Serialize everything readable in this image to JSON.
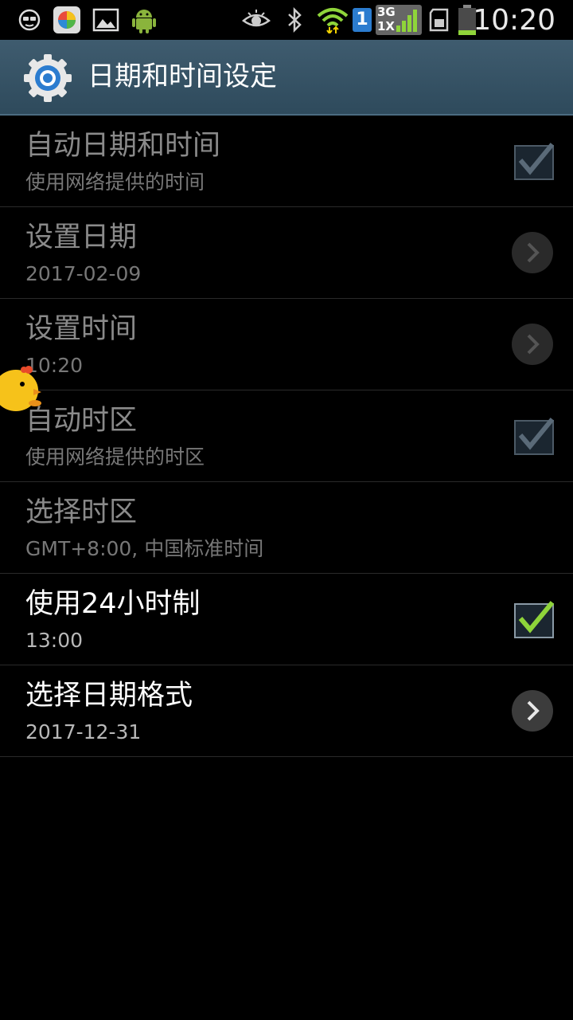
{
  "status_bar": {
    "time": "10:20",
    "icons": [
      "incognito-icon",
      "game-center-icon",
      "gallery-icon",
      "android-icon",
      "eye-icon",
      "bluetooth-icon",
      "wifi-icon",
      "sim1-icon",
      "signal-3g-1x-icon",
      "sd-card-icon",
      "battery-icon"
    ],
    "network_label_top": "3G",
    "network_label_bottom": "1X",
    "sim_label": "1"
  },
  "header": {
    "title": "日期和时间设定",
    "icon": "settings-gear-icon"
  },
  "items": [
    {
      "title": "自动日期和时间",
      "subtitle": "使用网络提供的时间",
      "control": "checkbox",
      "checked": true,
      "enabled": false
    },
    {
      "title": "设置日期",
      "subtitle": "2017-02-09",
      "control": "chevron",
      "enabled": false
    },
    {
      "title": "设置时间",
      "subtitle": "10:20",
      "control": "chevron",
      "enabled": false
    },
    {
      "title": "自动时区",
      "subtitle": "使用网络提供的时区",
      "control": "checkbox",
      "checked": true,
      "enabled": false
    },
    {
      "title": "选择时区",
      "subtitle": "GMT+8:00, 中国标准时间",
      "control": "none",
      "enabled": false
    },
    {
      "title": "使用24小时制",
      "subtitle": "13:00",
      "control": "checkbox",
      "checked": true,
      "enabled": true
    },
    {
      "title": "选择日期格式",
      "subtitle": "2017-12-31",
      "control": "chevron",
      "enabled": true
    }
  ],
  "colors": {
    "actionbar": "#3f5c6f",
    "check_active": "#8fd43a",
    "check_disabled": "#5a6a78"
  }
}
